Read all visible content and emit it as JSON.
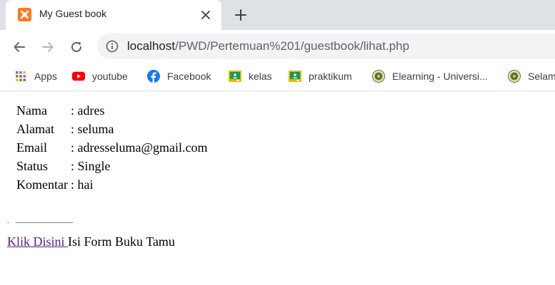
{
  "tab": {
    "title": "My Guest book",
    "close_glyph": "✕",
    "new_tab_glyph": "+"
  },
  "address_bar": {
    "host": "localhost",
    "path": "/PWD/Pertemuan%201/guestbook/lihat.php"
  },
  "bookmarks": [
    {
      "label": "Apps",
      "icon": "apps-grid-icon"
    },
    {
      "label": "youtube",
      "icon": "youtube-icon"
    },
    {
      "label": "Facebook",
      "icon": "facebook-icon"
    },
    {
      "label": "kelas",
      "icon": "google-classroom-icon"
    },
    {
      "label": "praktikum",
      "icon": "google-classroom-icon"
    },
    {
      "label": "Elearning - Universi...",
      "icon": "university-emblem-icon"
    },
    {
      "label": "Selam",
      "icon": "university-emblem-icon"
    }
  ],
  "guest_entry": {
    "separator": ":",
    "rows": [
      {
        "label": "Nama",
        "value": "adres"
      },
      {
        "label": "Alamat",
        "value": "seluma"
      },
      {
        "label": "Email",
        "value": "adresseluma@gmail.com"
      },
      {
        "label": "Status",
        "value": "Single"
      },
      {
        "label": "Komentar",
        "value": "hai"
      }
    ]
  },
  "footer": {
    "link_text": "Klik Disini ",
    "text": "Isi Form Buku Tamu"
  },
  "colors": {
    "tabstrip_bg": "#dee1e6",
    "favicon": "#fb7a24",
    "link_visited": "#551a8b",
    "youtube_red": "#ff0000",
    "facebook_blue": "#1877f2",
    "classroom_green": "#0f9d58",
    "classroom_yellow": "#f4b400"
  }
}
